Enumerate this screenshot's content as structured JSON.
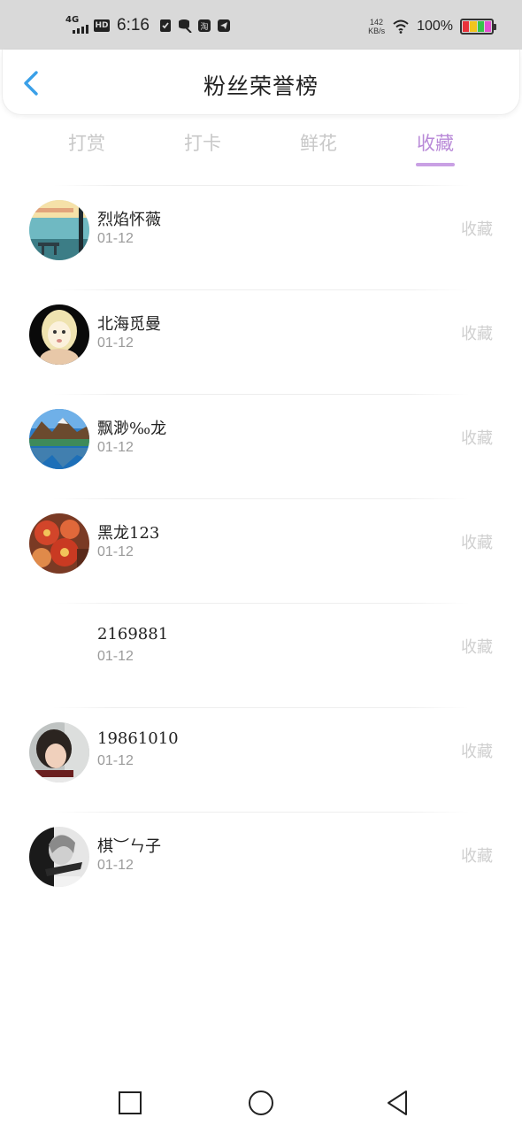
{
  "status_bar": {
    "network": "4G",
    "hd": "HD",
    "time": "6:16",
    "speed_value": "142",
    "speed_unit": "KB/s",
    "battery": "100%",
    "icons": [
      "signal-icon",
      "hd-icon",
      "check-shield-icon",
      "data-icon",
      "taobao-icon",
      "telegram-icon",
      "wifi-icon",
      "battery-icon"
    ]
  },
  "header": {
    "title": "粉丝荣誉榜",
    "back_icon": "chevron-left-icon",
    "accent": "#3aa0e8"
  },
  "tabs": [
    {
      "label": "打赏",
      "active": false
    },
    {
      "label": "打卡",
      "active": false
    },
    {
      "label": "鲜花",
      "active": false
    },
    {
      "label": "收藏",
      "active": true
    }
  ],
  "colors": {
    "active_tab": "#b98ad8",
    "inactive_tab": "#c8c8c8",
    "action_text": "#cfcfcf"
  },
  "fans": [
    {
      "name": "烈焰怀薇",
      "date": "01-12",
      "action": "收藏",
      "avatar": "seaside-avatar"
    },
    {
      "name": "北海觅曼",
      "date": "01-12",
      "action": "收藏",
      "avatar": "anime-girl-avatar"
    },
    {
      "name": "飘渺‰龙",
      "date": "01-12",
      "action": "收藏",
      "avatar": "lake-mountain-avatar"
    },
    {
      "name": "黑龙123",
      "date": "01-12",
      "action": "收藏",
      "avatar": "red-flower-avatar"
    },
    {
      "name": "2169881",
      "date": "01-12",
      "action": "收藏",
      "avatar": ""
    },
    {
      "name": "19861010",
      "date": "01-12",
      "action": "收藏",
      "avatar": "portrait-avatar"
    },
    {
      "name": "棋︶ㄣ子",
      "date": "01-12",
      "action": "收藏",
      "avatar": "bw-portrait-avatar"
    }
  ],
  "nav_bar": {
    "icons": [
      "recents-square-icon",
      "home-circle-icon",
      "back-triangle-icon"
    ]
  }
}
